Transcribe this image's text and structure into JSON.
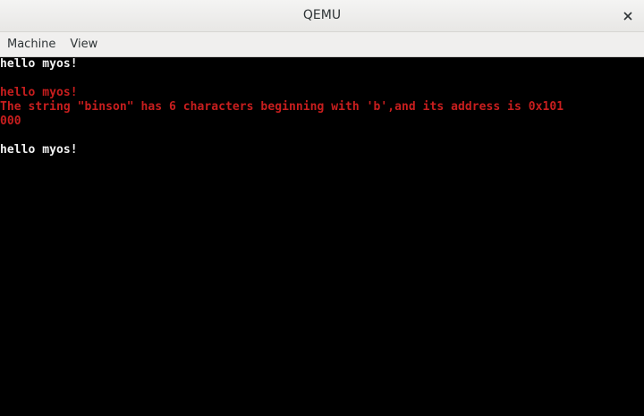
{
  "window": {
    "title": "QEMU",
    "close_glyph": "×"
  },
  "menubar": {
    "items": [
      {
        "label": "Machine"
      },
      {
        "label": "View"
      }
    ]
  },
  "console": {
    "colors": {
      "normal": "#f2f2f2",
      "highlight": "#c81e1e"
    },
    "lines": [
      {
        "text": "hello myos!",
        "color": "white"
      },
      {
        "text": "",
        "color": "white"
      },
      {
        "text": "hello myos!",
        "color": "red"
      },
      {
        "text": "The string \"binson\" has 6 characters beginning with 'b',and its address is 0x101",
        "color": "red"
      },
      {
        "text": "000",
        "color": "red"
      },
      {
        "text": "",
        "color": "white"
      },
      {
        "text": "hello myos!",
        "color": "white"
      }
    ]
  }
}
